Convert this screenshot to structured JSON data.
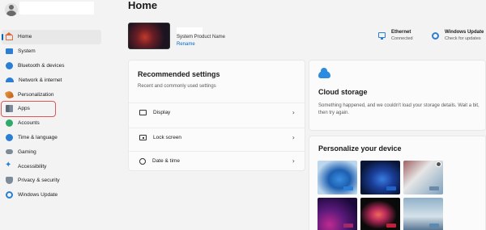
{
  "page": {
    "title": "Home"
  },
  "sidebar": {
    "items": [
      {
        "label": "Home",
        "icon": "home-icon"
      },
      {
        "label": "System",
        "icon": "system-icon"
      },
      {
        "label": "Bluetooth & devices",
        "icon": "bluetooth-icon"
      },
      {
        "label": "Network & internet",
        "icon": "network-icon"
      },
      {
        "label": "Personalization",
        "icon": "personalization-icon"
      },
      {
        "label": "Apps",
        "icon": "apps-icon"
      },
      {
        "label": "Accounts",
        "icon": "accounts-icon"
      },
      {
        "label": "Time & language",
        "icon": "time-language-icon"
      },
      {
        "label": "Gaming",
        "icon": "gaming-icon"
      },
      {
        "label": "Accessibility",
        "icon": "accessibility-icon"
      },
      {
        "label": "Privacy & security",
        "icon": "privacy-icon"
      },
      {
        "label": "Windows Update",
        "icon": "windows-update-icon"
      }
    ],
    "active": "Home",
    "highlighted": "Apps"
  },
  "device": {
    "model": "System Product Name",
    "rename": "Rename"
  },
  "status": {
    "ethernet": {
      "title": "Ethernet",
      "sub": "Connected"
    },
    "update": {
      "title": "Windows Update",
      "sub": "Check for updates"
    }
  },
  "recommended": {
    "title": "Recommended settings",
    "subtitle": "Recent and commonly used settings",
    "rows": [
      {
        "label": "Display",
        "icon": "display-icon"
      },
      {
        "label": "Lock screen",
        "icon": "lock-screen-icon"
      },
      {
        "label": "Date & time",
        "icon": "clock-icon"
      }
    ]
  },
  "cloud": {
    "title": "Cloud storage",
    "text": "Something happened, and we couldn't load your storage details. Wait a bit, then try again."
  },
  "personalize": {
    "title": "Personalize your device"
  },
  "colors": {
    "accent": "#0067c0",
    "highlight_outline": "#e05555"
  }
}
